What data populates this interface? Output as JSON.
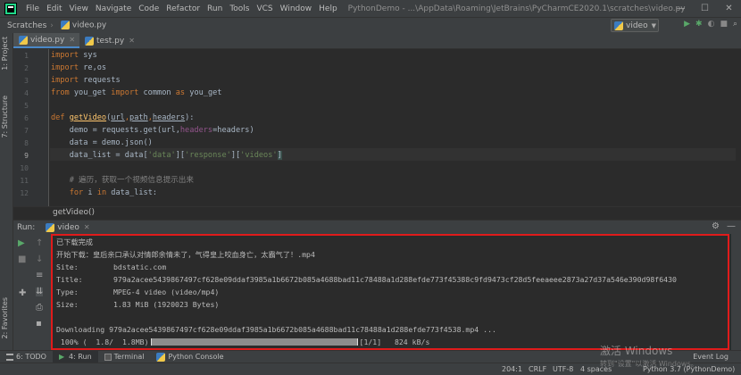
{
  "menu": [
    "File",
    "Edit",
    "View",
    "Navigate",
    "Code",
    "Refactor",
    "Run",
    "Tools",
    "VCS",
    "Window",
    "Help"
  ],
  "title": "PythonDemo - ...\\AppData\\Roaming\\JetBrains\\PyCharmCE2020.1\\scratches\\video.py",
  "window_controls": {
    "minimize": "—",
    "maximize": "☐",
    "close": "✕"
  },
  "navbar": {
    "crumb1": "Scratches",
    "crumb2": "video.py",
    "run_config": "video"
  },
  "left_tabs": {
    "project": "1: Project",
    "structure": "7: Structure",
    "favorites": "2: Favorites"
  },
  "editor_tabs": [
    {
      "label": "video.py",
      "active": true
    },
    {
      "label": "test.py",
      "active": false
    }
  ],
  "line_numbers": [
    "1",
    "2",
    "3",
    "4",
    "5",
    "6",
    "7",
    "8",
    "9",
    "10",
    "11",
    "12"
  ],
  "code": {
    "l1_kw": "import",
    "l1_rest": " sys",
    "l2_kw": "import",
    "l2_rest": " re,os",
    "l3_kw": "import",
    "l3_rest": " requests",
    "l4_kw1": "from",
    "l4_mod": " you_get ",
    "l4_kw2": "import",
    "l4_mid": " common ",
    "l4_kw3": "as",
    "l4_end": " you_get",
    "l6_kw": "def ",
    "l6_fn": "getVideo",
    "l6_open": "(",
    "l6_p1": "url",
    "l6_c1": ",",
    "l6_p2": "path",
    "l6_c2": ",",
    "l6_p3": "headers",
    "l6_close": "):",
    "l7_a": "    demo = requests.get(url,",
    "l7_kw": "headers",
    "l7_b": "=headers)",
    "l8": "    data = demo.json()",
    "l9_a": "    data_list = data[",
    "l9_s1": "'data'",
    "l9_b": "][",
    "l9_s2": "'response'",
    "l9_c": "][",
    "l9_s3": "'videos'",
    "l9_d": "]",
    "l11": "    # 遍历，获取一个视频信息提示出来",
    "l12_kw1": "for",
    "l12_mid": " i ",
    "l12_kw2": "in",
    "l12_end": " data_list:"
  },
  "editor_breadcrumb": "getVideo()",
  "run": {
    "label": "Run:",
    "tab": "video"
  },
  "console": {
    "l0": "已下载完成",
    "l1": "开始下载：皇后亲口承认对情郎余情未了，气得皇上咬血身亡，太霸气了！.mp4",
    "site_k": "Site:",
    "site_v": "bdstatic.com",
    "title_k": "Title:",
    "title_v": "979a2acee5439867497cf628e09ddaf3985a1b6672b085a4688bad11c78488a1d288efde773f45388c9fd9473cf28d5feeaeee2873a27d37a546e390d98f6430",
    "type_k": "Type:",
    "type_v": "MPEG-4 video (video/mp4)",
    "size_k": "Size:",
    "size_v": "1.83 MiB (1920023 Bytes)",
    "downloading": "Downloading 979a2acee5439867497cf628e09ddaf3985a1b6672b085a4688bad11c78488a1d288efde773f4538.mp4 ...",
    "prog_pct": " 100% (  1.8/  1.8MB)",
    "prog_tail": "[1/1]   824 kB/s",
    "progress_fraction": 1.0
  },
  "bottom_tabs": [
    {
      "label": "6: TODO",
      "active": false
    },
    {
      "label": "4: Run",
      "active": true
    },
    {
      "label": "Terminal",
      "active": false
    },
    {
      "label": "Python Console",
      "active": false
    }
  ],
  "event_log": "Event Log",
  "status": {
    "pos": "204:1",
    "eol": "CRLF",
    "enc": "UTF-8",
    "indent": "4 spaces",
    "interp": "Python 3.7 (PythonDemo)"
  },
  "watermark": {
    "line1": "激活 Windows",
    "line2": "转到\"设置\"以激活 Windows。"
  },
  "colors": {
    "highlight_border": "#e01b1b",
    "keyword": "#cc7832",
    "string": "#6a8759",
    "function": "#ffc66d",
    "param": "#94558d"
  }
}
